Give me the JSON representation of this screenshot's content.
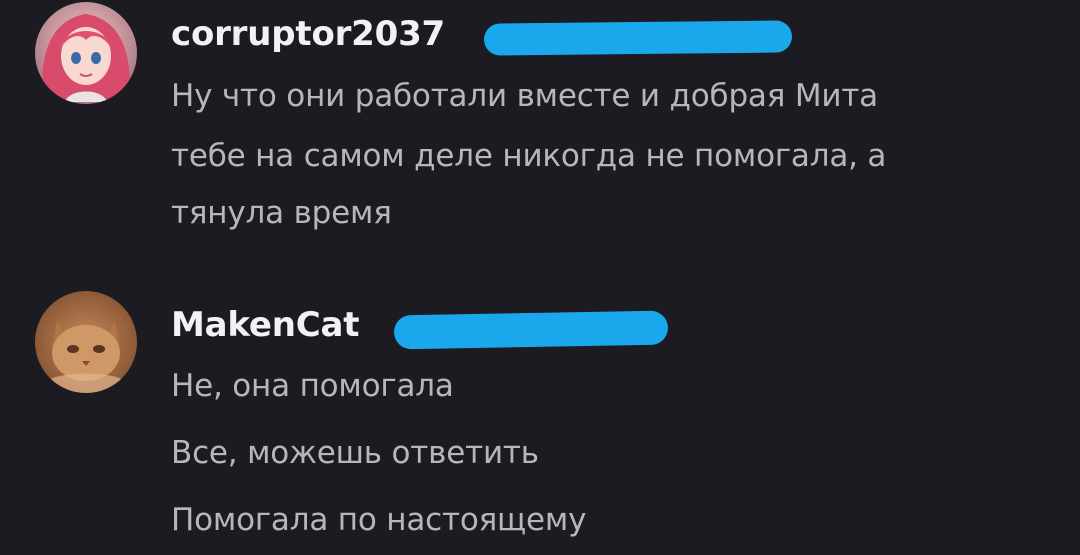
{
  "messages": [
    {
      "username": "corruptor2037",
      "avatar": "anime-girl-avatar",
      "lines": [
        "Ну что они работали вместе и добрая Мита",
        "тебе на самом деле никогда не помогала, а",
        "тянула время"
      ]
    },
    {
      "username": "MakenCat",
      "avatar": "cat-avatar",
      "lines": [
        "Не, она помогала",
        "Все, можешь ответить",
        "Помогала по настоящему"
      ]
    }
  ],
  "colors": {
    "background": "#1c1b21",
    "username": "#f2f2f5",
    "message_text": "#b6b6bd",
    "redaction": "#1aa7ec"
  }
}
